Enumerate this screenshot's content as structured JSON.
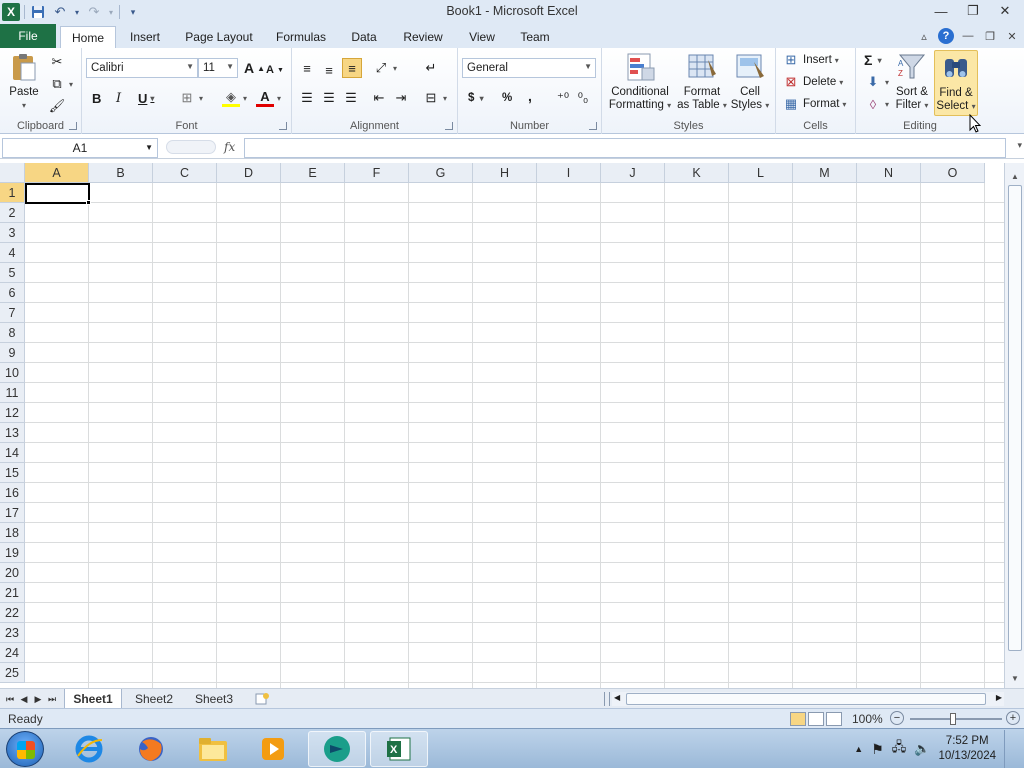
{
  "window": {
    "title": "Book1  -  Microsoft Excel",
    "controls": [
      "minimize",
      "restore",
      "close"
    ]
  },
  "quick_access": {
    "icons": [
      "excel-logo-icon",
      "save-icon",
      "undo-icon",
      "redo-icon",
      "customize-icon"
    ],
    "logo_letter": "X"
  },
  "tabs": {
    "file": "File",
    "items": [
      "Home",
      "Insert",
      "Page Layout",
      "Formulas",
      "Data",
      "Review",
      "View",
      "Team"
    ],
    "active": "Home"
  },
  "ribbon": {
    "clipboard": {
      "label": "Clipboard",
      "paste": "Paste"
    },
    "font": {
      "label": "Font",
      "font_name": "Calibri",
      "font_size": "11",
      "bold": "B",
      "italic": "I",
      "underline": "U",
      "grow": "A",
      "shrink": "A",
      "font_color_letter": "A"
    },
    "alignment": {
      "label": "Alignment"
    },
    "number": {
      "label": "Number",
      "format": "General",
      "currency": "$",
      "percent": "%",
      "comma": ","
    },
    "styles": {
      "label": "Styles",
      "conditional_line1": "Conditional",
      "conditional_line2": "Formatting",
      "format_table_line1": "Format",
      "format_table_line2": "as Table",
      "cell_styles_line1": "Cell",
      "cell_styles_line2": "Styles"
    },
    "cells": {
      "label": "Cells",
      "insert": "Insert",
      "delete": "Delete",
      "format": "Format"
    },
    "editing": {
      "label": "Editing",
      "sum": "Σ",
      "sort_line1": "Sort &",
      "sort_line2": "Filter",
      "find_line1": "Find &",
      "find_line2": "Select"
    }
  },
  "formula_bar": {
    "name_box": "A1",
    "fx": "fx",
    "value": ""
  },
  "grid": {
    "columns": [
      "A",
      "B",
      "C",
      "D",
      "E",
      "F",
      "G",
      "H",
      "I",
      "J",
      "K",
      "L",
      "M",
      "N",
      "O"
    ],
    "rows": [
      "1",
      "2",
      "3",
      "4",
      "5",
      "6",
      "7",
      "8",
      "9",
      "10",
      "11",
      "12",
      "13",
      "14",
      "15",
      "16",
      "17",
      "18",
      "19",
      "20",
      "21",
      "22",
      "23",
      "24",
      "25"
    ],
    "active_cell": "A1"
  },
  "sheets": {
    "items": [
      "Sheet1",
      "Sheet2",
      "Sheet3"
    ],
    "active": "Sheet1"
  },
  "status": {
    "text": "Ready",
    "zoom": "100%"
  },
  "taskbar": {
    "apps": [
      "internet-explorer-icon",
      "firefox-icon",
      "file-explorer-icon",
      "media-player-icon",
      "app-icon",
      "excel-icon"
    ],
    "time": "7:52 PM",
    "date": "10/13/2024"
  },
  "colors": {
    "excel_green": "#1e7145",
    "selected_header": "#f7d684",
    "ribbon_bg": "#dfe9f5"
  }
}
